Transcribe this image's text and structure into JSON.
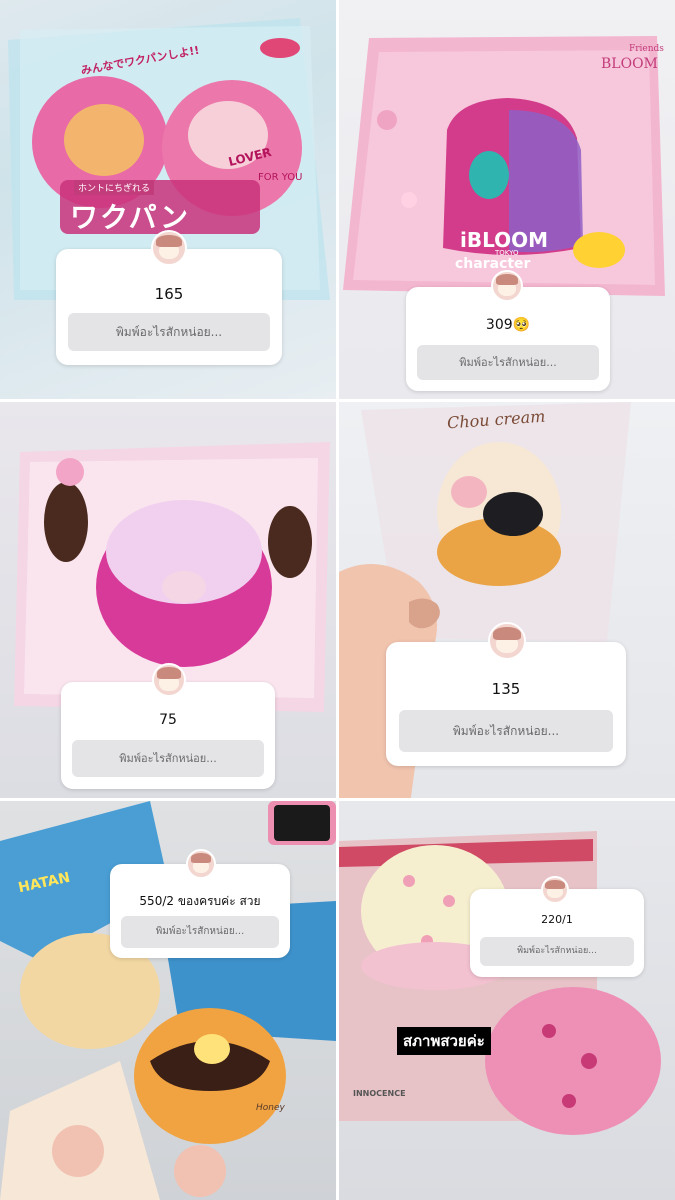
{
  "tiles": [
    {
      "answer": "165",
      "placeholder": "พิมพ์อะไรสักหน่อย..."
    },
    {
      "answer": "309🥺",
      "placeholder": "พิมพ์อะไรสักหน่อย..."
    },
    {
      "answer": "75",
      "placeholder": "พิมพ์อะไรสักหน่อย..."
    },
    {
      "answer": "135",
      "placeholder": "พิมพ์อะไรสักหน่อย..."
    },
    {
      "answer": "550/2 ของครบค่ะ สวย",
      "placeholder": "พิมพ์อะไรสักหน่อย..."
    },
    {
      "answer": "220/1",
      "placeholder": "พิมพ์อะไรสักหน่อย..."
    }
  ],
  "package_text": {
    "t1_title": "ワクパン",
    "t1_sub": "ホントにちぎれる",
    "t1_top": "みんなでワクパンしよ!!",
    "t1_lover": "LOVER",
    "t1_foryou": "FOR YOU",
    "t2_bloom": "BLOOM",
    "t2_friends": "Friends",
    "t2_ibloom": "iBLOOM",
    "t2_tokyo": "TOKYO",
    "t2_character": "character",
    "t4_chou": "Chou cream",
    "t5_brand": "HATAN",
    "t5_honey": "Honey",
    "t6_innocence": "INNOCENCE"
  },
  "overlay": {
    "caption": "สภาพสวยค่ะ"
  }
}
